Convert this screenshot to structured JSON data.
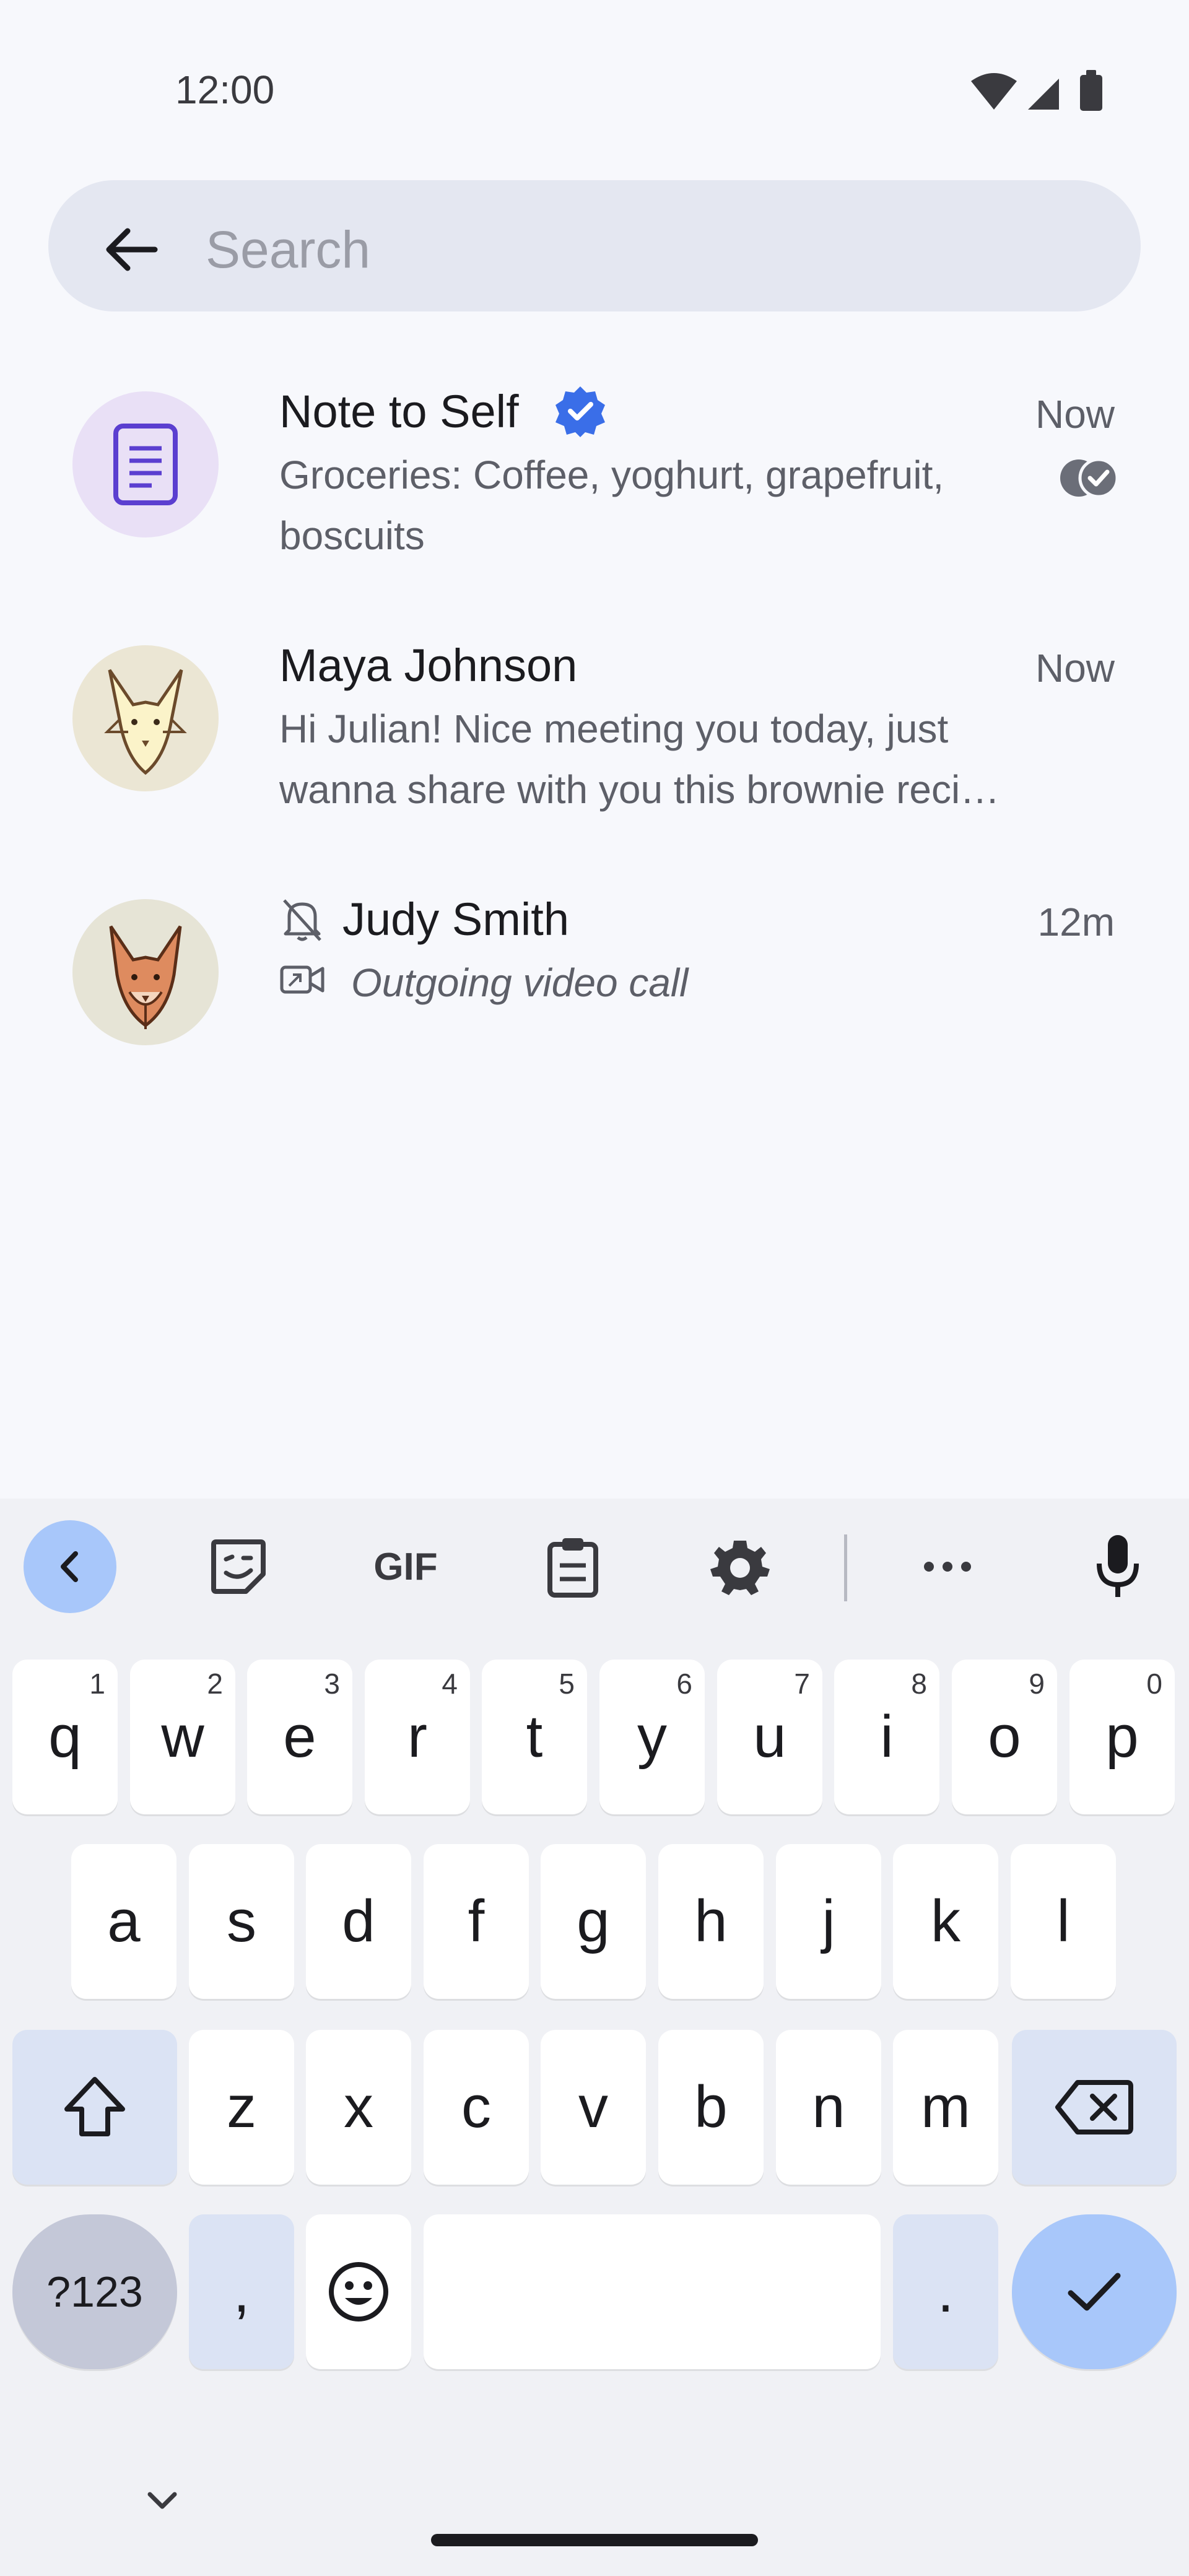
{
  "status_bar": {
    "time": "12:00"
  },
  "search": {
    "placeholder": "Search",
    "value": ""
  },
  "conversations": [
    {
      "name": "Note to Self",
      "verified": true,
      "time": "Now",
      "preview_line1": "Groceries: Coffee, yoghurt, grapefruit,",
      "preview_line2": "boscuits",
      "status": "read"
    },
    {
      "name": "Maya Johnson",
      "time": "Now",
      "preview_line1": "Hi Julian! Nice meeting you today, just",
      "preview_line2": "wanna share with you this brownie reci…"
    },
    {
      "name": "Judy Smith",
      "muted": true,
      "time": "12m",
      "preview_line1": "Outgoing video call"
    }
  ],
  "keyboard": {
    "toolbar": [
      "collapse-toolbar",
      "sticker",
      "GIF",
      "clipboard",
      "settings",
      "more",
      "microphone"
    ],
    "row1": [
      {
        "k": "q",
        "h": "1"
      },
      {
        "k": "w",
        "h": "2"
      },
      {
        "k": "e",
        "h": "3"
      },
      {
        "k": "r",
        "h": "4"
      },
      {
        "k": "t",
        "h": "5"
      },
      {
        "k": "y",
        "h": "6"
      },
      {
        "k": "u",
        "h": "7"
      },
      {
        "k": "i",
        "h": "8"
      },
      {
        "k": "o",
        "h": "9"
      },
      {
        "k": "p",
        "h": "0"
      }
    ],
    "row2": [
      "a",
      "s",
      "d",
      "f",
      "g",
      "h",
      "j",
      "k",
      "l"
    ],
    "row3": [
      "z",
      "x",
      "c",
      "v",
      "b",
      "n",
      "m"
    ],
    "symbols_label": "?123",
    "comma": ",",
    "period": ".",
    "colors": {
      "accent": "#a8c7fa",
      "special_key": "#dbe3f4",
      "symbols_key": "#c4c8d8"
    }
  },
  "colors": {
    "background": "#f7f8fc",
    "search_bg": "#e4e7f1",
    "verified": "#3a6ee8",
    "note_avatar_bg": "#e9e0f6",
    "note_icon": "#5b3fd0"
  }
}
